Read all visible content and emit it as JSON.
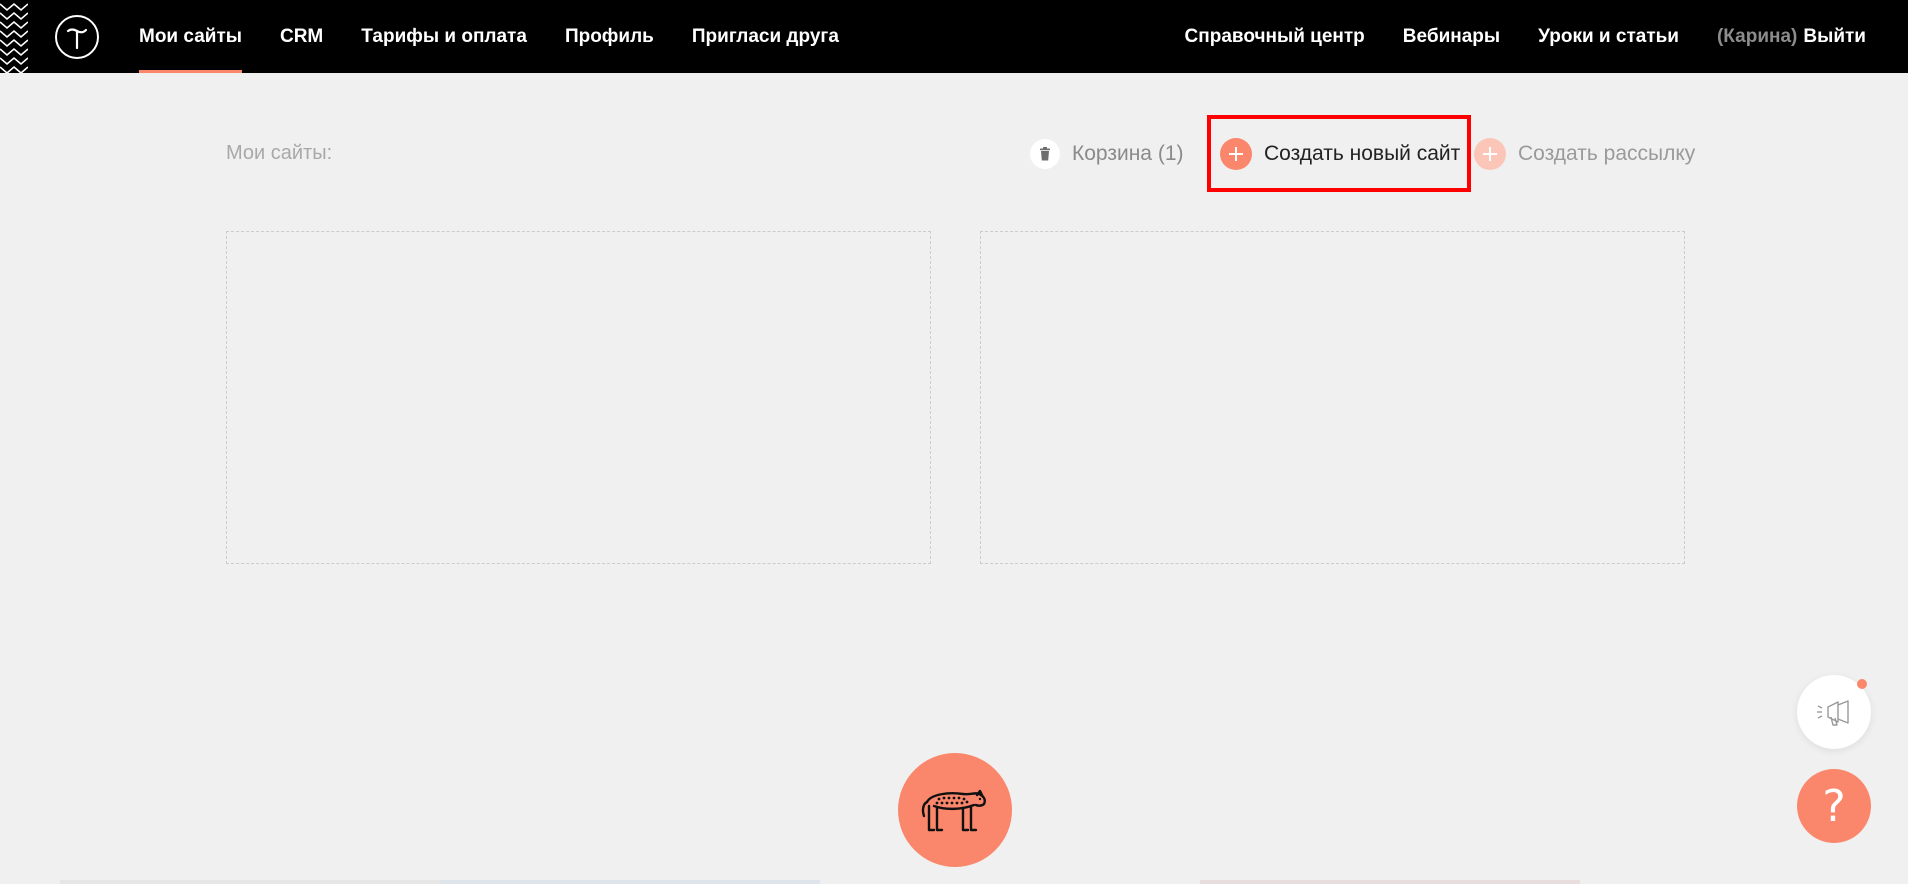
{
  "header": {
    "logo_letter": "T",
    "nav_left": [
      {
        "label": "Мои сайты",
        "active": true
      },
      {
        "label": "CRM",
        "active": false
      },
      {
        "label": "Тарифы и оплата",
        "active": false
      },
      {
        "label": "Профиль",
        "active": false
      },
      {
        "label": "Пригласи друга",
        "active": false
      }
    ],
    "nav_right": [
      {
        "label": "Справочный центр"
      },
      {
        "label": "Вебинары"
      },
      {
        "label": "Уроки и статьи"
      }
    ],
    "user_name": "(Карина)",
    "logout_label": "Выйти"
  },
  "toolbar": {
    "page_label": "Мои сайты:",
    "trash_label": "Корзина (1)",
    "create_site_label": "Создать новый сайт",
    "create_newsletter_label": "Создать рассылку"
  },
  "help": {
    "label": "?"
  },
  "icons": {
    "trash": "trash-icon",
    "plus": "plus-icon",
    "announce": "megaphone-icon",
    "mascot": "leopard-icon"
  },
  "colors": {
    "accent": "#fa876b",
    "header_bg": "#000000",
    "page_bg": "#f0f0f0",
    "highlight": "#ff0000"
  }
}
